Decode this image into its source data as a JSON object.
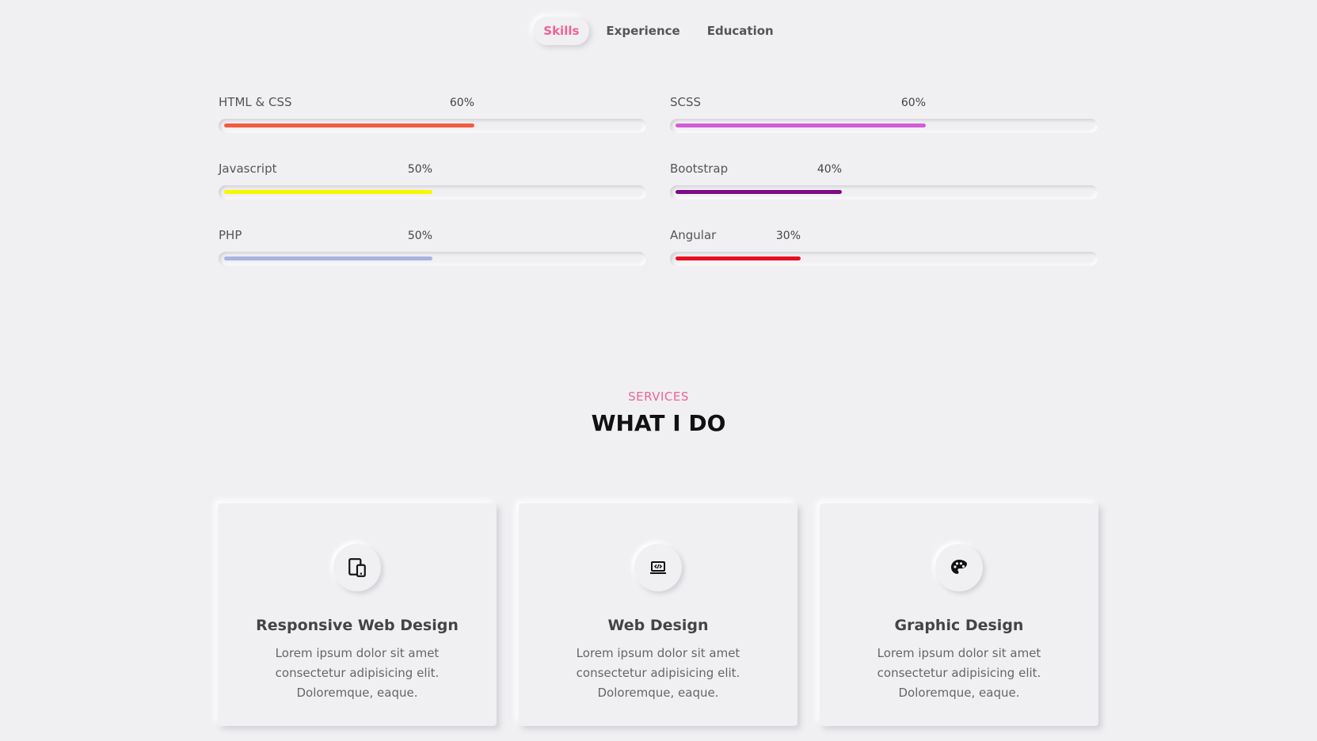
{
  "tabs": [
    {
      "label": "Skills",
      "active": true
    },
    {
      "label": "Experience",
      "active": false
    },
    {
      "label": "Education",
      "active": false
    }
  ],
  "skills": [
    {
      "name": "HTML & CSS",
      "percent_label": "60%",
      "percent": 60,
      "color": "#f35b3f"
    },
    {
      "name": "SCSS",
      "percent_label": "60%",
      "percent": 60,
      "color": "#d35cd6"
    },
    {
      "name": "Javascript",
      "percent_label": "50%",
      "percent": 50,
      "color": "#f7f700"
    },
    {
      "name": "Bootstrap",
      "percent_label": "40%",
      "percent": 40,
      "color": "#7c0a86"
    },
    {
      "name": "PHP",
      "percent_label": "50%",
      "percent": 50,
      "color": "#a8b4e0"
    },
    {
      "name": "Angular",
      "percent_label": "30%",
      "percent": 30,
      "color": "#e8101e"
    }
  ],
  "services": {
    "label": "SERVICES",
    "title": "WHAT I DO",
    "cards": [
      {
        "icon": "devices-icon",
        "title": "Responsive Web Design",
        "text": "Lorem ipsum dolor sit amet consectetur adipisicing elit. Doloremque, eaque."
      },
      {
        "icon": "laptop-code-icon",
        "title": "Web Design",
        "text": "Lorem ipsum dolor sit amet consectetur adipisicing elit. Doloremque, eaque."
      },
      {
        "icon": "palette-icon",
        "title": "Graphic Design",
        "text": "Lorem ipsum dolor sit amet consectetur adipisicing elit. Doloremque, eaque."
      }
    ]
  },
  "colors": {
    "accent": "#f06292",
    "background": "#f0f0f3"
  }
}
